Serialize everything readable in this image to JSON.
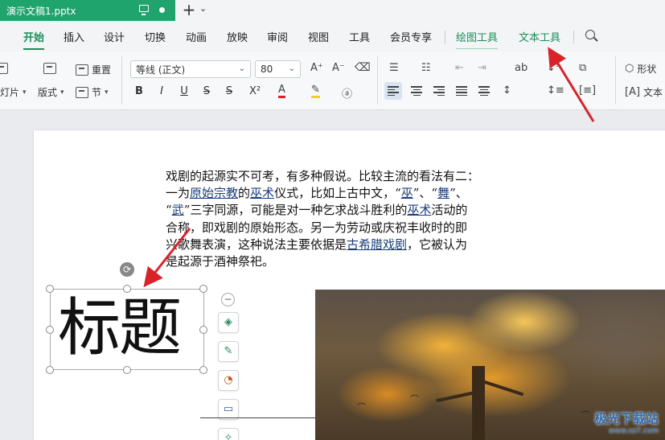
{
  "titlebar": {
    "doc_name": "演示文稿1.pptx",
    "new_tab_glyph": "+",
    "new_tab_chevron": "⌄"
  },
  "menu": {
    "tabs": [
      "开始",
      "插入",
      "设计",
      "切换",
      "动画",
      "放映",
      "审阅",
      "视图",
      "工具",
      "会员专享"
    ],
    "tool_tabs": [
      "绘图工具",
      "文本工具"
    ],
    "active": "开始"
  },
  "ribbon": {
    "slide_label": "灯片",
    "layout_label": "版式",
    "reset_label": "重置",
    "section_label": "节",
    "font_name": "等线 (正文)",
    "font_size": "80",
    "format_buttons": [
      "B",
      "I",
      "U",
      "S",
      "S",
      "X²"
    ],
    "shape_label": "形状",
    "textbox_label": "文本"
  },
  "slide": {
    "paragraph": {
      "line1": "戏剧的起源实不可考，有多种假说。比较主流的看法有二：",
      "line2_a": "一为",
      "line2_link1": "原始宗教",
      "line2_b": "的",
      "line2_link2": "巫术",
      "line2_c": "仪式，比如上古中文，“",
      "line2_link3": "巫",
      "line2_d": "”、“",
      "line2_link4": "舞",
      "line2_e": "”、",
      "line3_a": "“",
      "line3_link1": "武",
      "line3_b": "”三字同源，可能是对一种乞求战斗胜利的",
      "line3_link2": "巫术",
      "line3_c": "活动的",
      "line4": "合称，即戏剧的原始形态。另一为劳动或庆祝丰收时的即",
      "line5_a": "兴歌舞表演，这种说法主要依据是",
      "line5_link": "古希腊戏剧",
      "line5_b": "，它被认为",
      "line6": "是起源于酒神祭祀。"
    },
    "title_text": "标题",
    "watermark": "极光下载站",
    "watermark_sub": "www.xz7.com"
  },
  "colors": {
    "accent": "#1a8f5c",
    "doc_tab": "#20a46e",
    "arrow": "#d9232b",
    "link": "#1a3d7a"
  }
}
